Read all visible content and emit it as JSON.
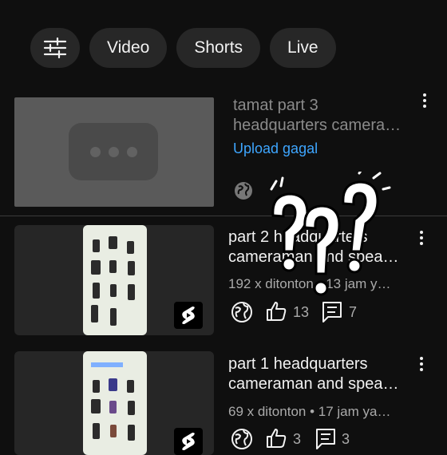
{
  "chips": [
    {
      "icon": "sliders-icon"
    },
    {
      "label": "Video"
    },
    {
      "label": "Shorts"
    },
    {
      "label": "Live"
    }
  ],
  "videos": [
    {
      "title": "tamat part 3\nheadquarters camera…",
      "status": "Upload gagal",
      "status_color": "#3ea6ff",
      "visibility_icon": "globe-icon"
    },
    {
      "title": "part 2 headquarters\ncameraman and spea…",
      "meta": "192 x ditonton • 13 jam y…",
      "likes": "13",
      "comments": "7",
      "badge_icon": "shorts-icon"
    },
    {
      "title": "part 1 headquarters\ncameraman and spea…",
      "meta": "69 x ditonton • 17 jam ya…",
      "likes": "3",
      "comments": "3",
      "badge_icon": "shorts-icon"
    }
  ],
  "overlay": {
    "content": "???"
  }
}
